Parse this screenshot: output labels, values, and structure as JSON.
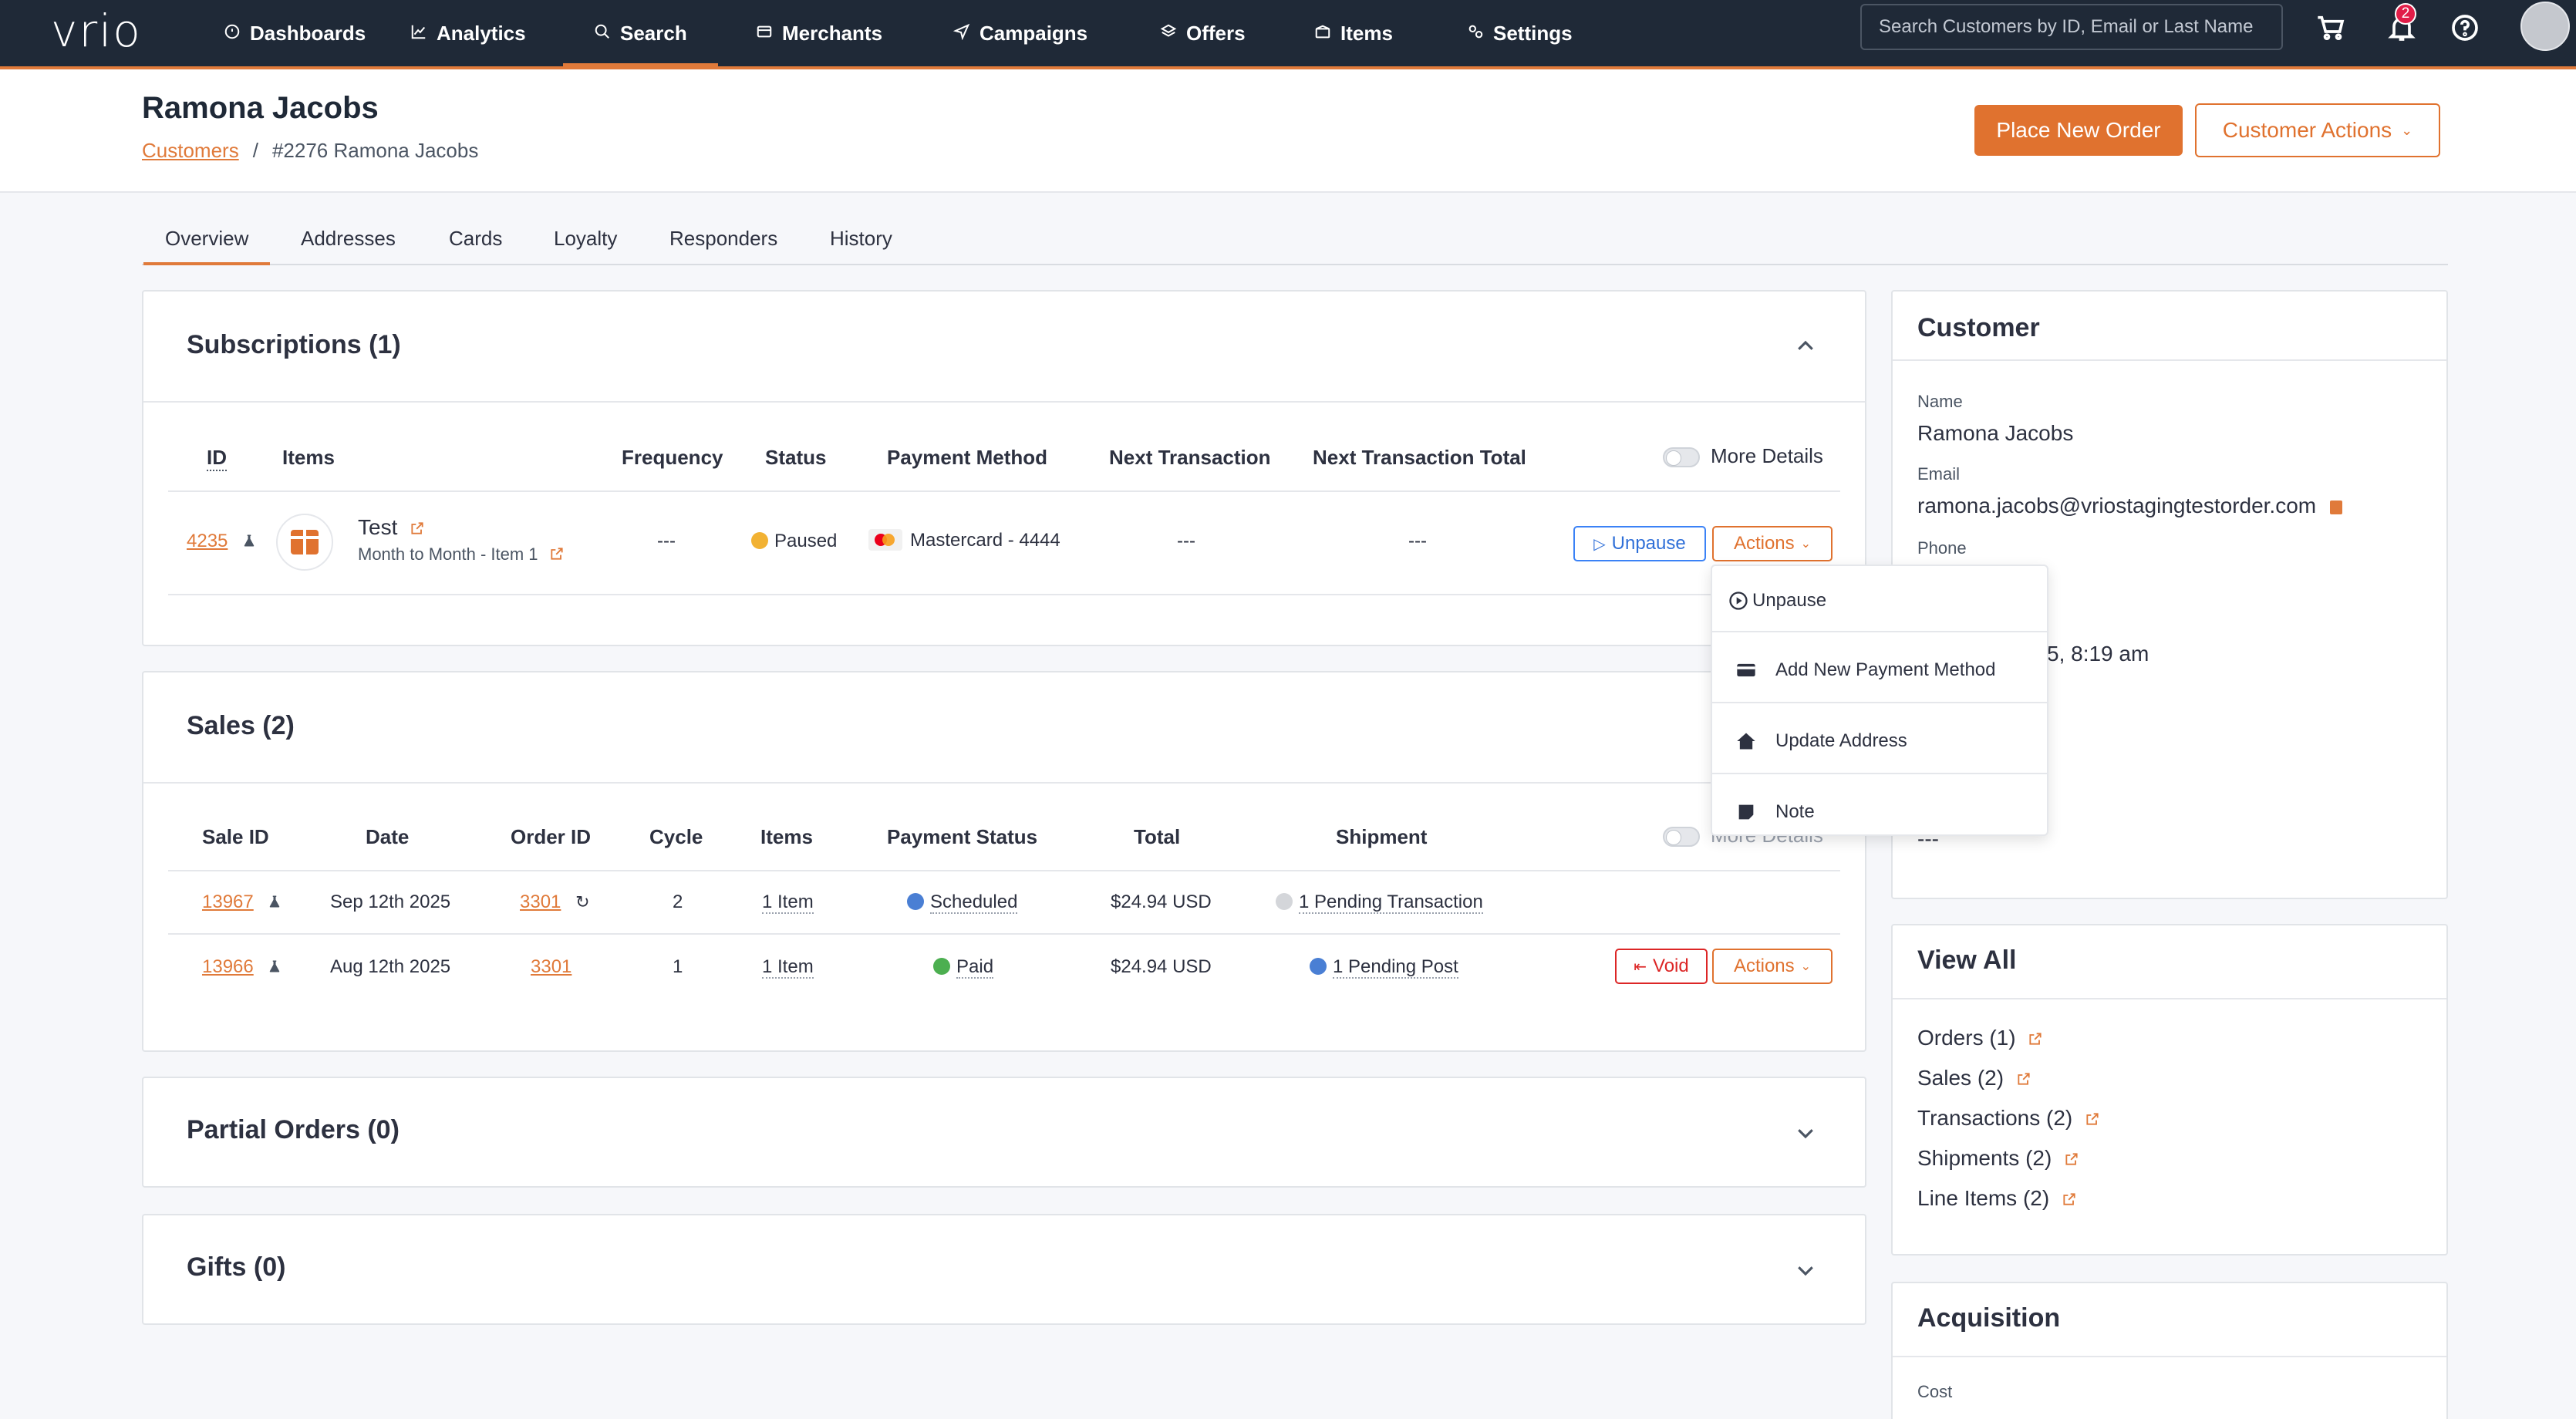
{
  "brand": {
    "logo_text": "vrio",
    "accent": "#e07a3a",
    "nav_bg": "#1f2937"
  },
  "nav": {
    "items": [
      {
        "label": "Dashboards",
        "icon": "dashboard-icon"
      },
      {
        "label": "Analytics",
        "icon": "analytics-icon"
      },
      {
        "label": "Search",
        "icon": "search-icon",
        "active": true
      },
      {
        "label": "Merchants",
        "icon": "merchants-icon"
      },
      {
        "label": "Campaigns",
        "icon": "campaigns-icon"
      },
      {
        "label": "Offers",
        "icon": "offers-icon"
      },
      {
        "label": "Items",
        "icon": "items-icon"
      },
      {
        "label": "Settings",
        "icon": "settings-icon"
      }
    ],
    "search_placeholder": "Search Customers by ID, Email or Last Name",
    "notification_count": "2"
  },
  "header": {
    "title": "Ramona Jacobs",
    "breadcrumb_link": "Customers",
    "breadcrumb_sep": "/",
    "breadcrumb_current": "#2276 Ramona Jacobs",
    "place_order": "Place New Order",
    "customer_actions": "Customer Actions"
  },
  "tabs": [
    "Overview",
    "Addresses",
    "Cards",
    "Loyalty",
    "Responders",
    "History"
  ],
  "subscriptions": {
    "title": "Subscriptions (1)",
    "columns": [
      "ID",
      "Items",
      "Frequency",
      "Status",
      "Payment Method",
      "Next Transaction",
      "Next Transaction Total"
    ],
    "more_details": "More Details",
    "row": {
      "id": "4235",
      "item_name": "Test",
      "item_sub": "Month to Month - Item 1",
      "frequency": "---",
      "status": "Paused",
      "status_color": "#f2b233",
      "payment": "Mastercard - 4444",
      "next_tx": "---",
      "next_total": "---",
      "unpause": "Unpause",
      "actions": "Actions"
    }
  },
  "dropdown": {
    "items": [
      "Unpause",
      "Add New Payment Method",
      "Update Address",
      "Note"
    ]
  },
  "sales": {
    "title": "Sales (2)",
    "columns": [
      "Sale ID",
      "Date",
      "Order ID",
      "Cycle",
      "Items",
      "Payment Status",
      "Total",
      "Shipment"
    ],
    "more_details": "More Details",
    "rows": [
      {
        "sale_id": "13967",
        "date": "Sep 12th 2025",
        "order_id": "3301",
        "cycle": "2",
        "items": "1 Item",
        "payment_status": "Scheduled",
        "status_color": "#4a7fd4",
        "total": "$24.94 USD",
        "shipment": "1 Pending Transaction",
        "ship_color": "#d4d6da"
      },
      {
        "sale_id": "13966",
        "date": "Aug 12th 2025",
        "order_id": "3301",
        "cycle": "1",
        "items": "1 Item",
        "payment_status": "Paid",
        "status_color": "#4caf50",
        "total": "$24.94 USD",
        "shipment": "1 Pending Post",
        "ship_color": "#4a7fd4",
        "void": "Void",
        "actions": "Actions"
      }
    ]
  },
  "partial_orders": {
    "title": "Partial Orders (0)"
  },
  "gifts": {
    "title": "Gifts (0)"
  },
  "customer": {
    "title": "Customer",
    "name_label": "Name",
    "name": "Ramona Jacobs",
    "email_label": "Email",
    "email": "ramona.jacobs@vriostagingtestorder.com",
    "phone_label": "Phone",
    "partial_date": "5, 8:19 am",
    "partial_dash": "---"
  },
  "view_all": {
    "title": "View All",
    "links": [
      "Orders (1)",
      "Sales (2)",
      "Transactions (2)",
      "Shipments (2)",
      "Line Items (2)"
    ]
  },
  "acquisition": {
    "title": "Acquisition",
    "cost_label": "Cost"
  }
}
